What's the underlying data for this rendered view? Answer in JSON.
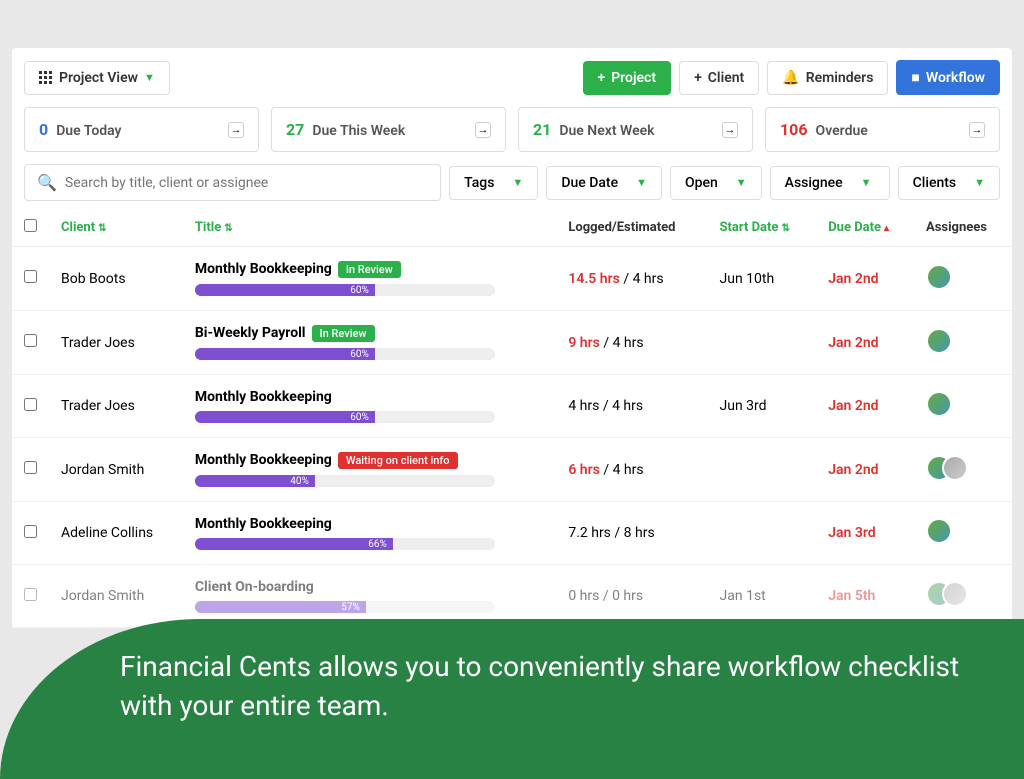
{
  "toolbar": {
    "view_label": "Project View",
    "project_btn": "Project",
    "client_btn": "Client",
    "reminders_btn": "Reminders",
    "workflow_btn": "Workflow"
  },
  "stats": [
    {
      "count": "0",
      "label": "Due Today",
      "cls": "blue"
    },
    {
      "count": "27",
      "label": "Due This Week",
      "cls": "green"
    },
    {
      "count": "21",
      "label": "Due Next Week",
      "cls": "green"
    },
    {
      "count": "106",
      "label": "Overdue",
      "cls": "red"
    }
  ],
  "search_placeholder": "Search by title, client or assignee",
  "filters": {
    "tags": "Tags",
    "due_date": "Due Date",
    "open": "Open",
    "assignee": "Assignee",
    "clients": "Clients"
  },
  "columns": {
    "client": "Client",
    "title": "Title",
    "logged": "Logged/Estimated",
    "start": "Start Date",
    "due": "Due Date",
    "assignees": "Assignees"
  },
  "rows": [
    {
      "client": "Bob Boots",
      "title": "Monthly Bookkeeping",
      "badge": "In Review",
      "badge_cls": "green",
      "pct": "60%",
      "logged": "14.5 hrs",
      "est": "4 hrs",
      "over": true,
      "start": "Jun 10th",
      "due": "Jan 2nd",
      "avatars": 1
    },
    {
      "client": "Trader Joes",
      "title": "Bi-Weekly Payroll",
      "badge": "In Review",
      "badge_cls": "green",
      "pct": "60%",
      "logged": "9 hrs",
      "est": "4 hrs",
      "over": true,
      "start": "",
      "due": "Jan 2nd",
      "avatars": 1
    },
    {
      "client": "Trader Joes",
      "title": "Monthly Bookkeeping",
      "badge": "",
      "badge_cls": "",
      "pct": "60%",
      "logged": "4 hrs",
      "est": "4 hrs",
      "over": false,
      "start": "Jun 3rd",
      "due": "Jan 2nd",
      "avatars": 1
    },
    {
      "client": "Jordan Smith",
      "title": "Monthly Bookkeeping",
      "badge": "Waiting on client info",
      "badge_cls": "red",
      "pct": "40%",
      "logged": "6 hrs",
      "est": "4 hrs",
      "over": true,
      "start": "",
      "due": "Jan 2nd",
      "avatars": 2
    },
    {
      "client": "Adeline Collins",
      "title": "Monthly Bookkeeping",
      "badge": "",
      "badge_cls": "",
      "pct": "66%",
      "logged": "7.2 hrs",
      "est": "8 hrs",
      "over": false,
      "start": "",
      "due": "Jan 3rd",
      "avatars": 1
    },
    {
      "client": "Jordan Smith",
      "title": "Client On-boarding",
      "badge": "",
      "badge_cls": "",
      "pct": "57%",
      "logged": "0 hrs",
      "est": "0 hrs",
      "over": false,
      "start": "Jan 1st",
      "due": "Jan 5th",
      "avatars": 2,
      "obscured": true
    }
  ],
  "banner_text": "Financial Cents allows you to conveniently share workflow checklist with your entire team."
}
